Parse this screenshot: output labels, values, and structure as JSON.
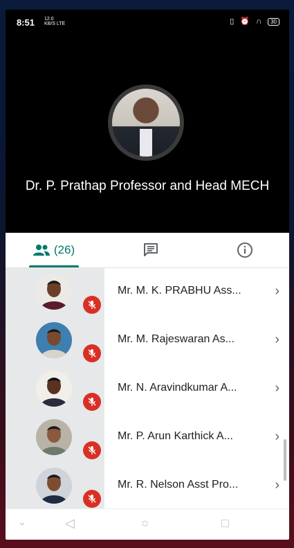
{
  "status": {
    "time": "8:51",
    "net_top": "12.0",
    "net_bottom": "KB/S LTE",
    "battery": "30"
  },
  "speaker": {
    "name": "Dr. P. Prathap Professor and Head MECH"
  },
  "tabs": {
    "people_count": "(26)"
  },
  "participants": [
    {
      "name": "Mr. M. K. PRABHU Ass...",
      "avatar_bg": "#5b1b2a",
      "skin": "#6b3e26"
    },
    {
      "name": "Mr. M. Rajeswaran As...",
      "avatar_bg": "#3e7fb0",
      "skin": "#7a4a2e"
    },
    {
      "name": "Mr. N. Aravindkumar A...",
      "avatar_bg": "#2b2b3d",
      "skin": "#5a3220"
    },
    {
      "name": "Mr. P. Arun Karthick A...",
      "avatar_bg": "#b9b2a6",
      "skin": "#8a5a3c"
    },
    {
      "name": "Mr. R. Nelson Asst Pro...",
      "avatar_bg": "#cfd4da",
      "skin": "#7d4d31"
    }
  ],
  "colors": {
    "accent": "#00796b",
    "muted_mic": "#d93025"
  }
}
